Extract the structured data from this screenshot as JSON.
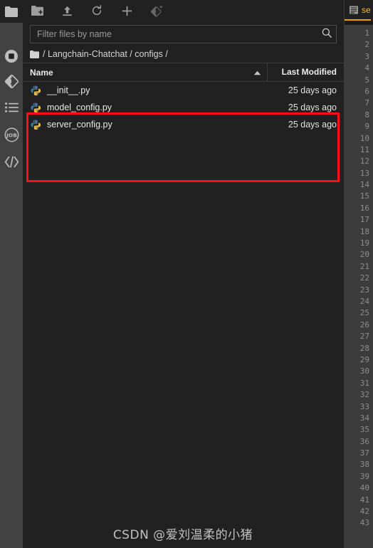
{
  "activity_bar": {
    "items": [
      {
        "name": "file-browser",
        "icon": "folder-icon",
        "active": true
      },
      {
        "name": "running-terminals-kernels",
        "icon": "stop-circle-icon",
        "active": false
      },
      {
        "name": "git-panel",
        "icon": "git-diamond-icon",
        "active": false
      },
      {
        "name": "table-of-contents",
        "icon": "list-icon",
        "active": false
      },
      {
        "name": "jobs-panel",
        "icon": "job-circle-icon",
        "active": false
      },
      {
        "name": "extension-manager",
        "icon": "code-brackets-icon",
        "active": false
      }
    ]
  },
  "file_browser": {
    "toolbar": [
      {
        "name": "new-folder-button",
        "icon": "new-folder-icon",
        "dim": false
      },
      {
        "name": "upload-files-button",
        "icon": "upload-icon",
        "dim": false
      },
      {
        "name": "refresh-file-list-button",
        "icon": "refresh-icon",
        "dim": false
      },
      {
        "name": "new-launcher-button",
        "icon": "plus-icon",
        "dim": false
      },
      {
        "name": "git-clone-button",
        "icon": "git-diamond-plus-icon",
        "dim": true
      }
    ],
    "filter": {
      "value": "",
      "placeholder": "Filter files by name",
      "icon": "search-icon"
    },
    "breadcrumb": {
      "home_icon": "folder-icon",
      "separator": "/",
      "crumbs": [
        "Langchain-Chatchat",
        "configs"
      ],
      "full_text": "/ Langchain-Chatchat / configs /"
    },
    "columns": {
      "name_header": "Name",
      "modified_header": "Last Modified",
      "sort_direction": "ascending",
      "sort_icon": "caret-up-icon"
    },
    "files": [
      {
        "name": "__init__.py",
        "icon": "python-file-icon",
        "modified": "25 days ago",
        "highlighted": false
      },
      {
        "name": "model_config.py",
        "icon": "python-file-icon",
        "modified": "25 days ago",
        "highlighted": true
      },
      {
        "name": "server_config.py",
        "icon": "python-file-icon",
        "modified": "25 days ago",
        "highlighted": true
      }
    ],
    "annotation": {
      "name": "red-highlight-rectangle",
      "color": "#fc0d1c"
    }
  },
  "editor": {
    "tab": {
      "label": "se",
      "icon": "text-file-icon",
      "accent_color": "#f0a000"
    },
    "gutter": {
      "first_line": 1,
      "last_line": 43,
      "lines": [
        1,
        2,
        3,
        4,
        5,
        6,
        7,
        8,
        9,
        10,
        11,
        12,
        13,
        14,
        15,
        16,
        17,
        18,
        19,
        20,
        21,
        22,
        23,
        24,
        25,
        26,
        27,
        28,
        29,
        30,
        31,
        32,
        33,
        34,
        35,
        36,
        37,
        38,
        39,
        40,
        41,
        42,
        43
      ]
    }
  },
  "watermark": {
    "text": "CSDN @爱刘温柔的小猪"
  }
}
